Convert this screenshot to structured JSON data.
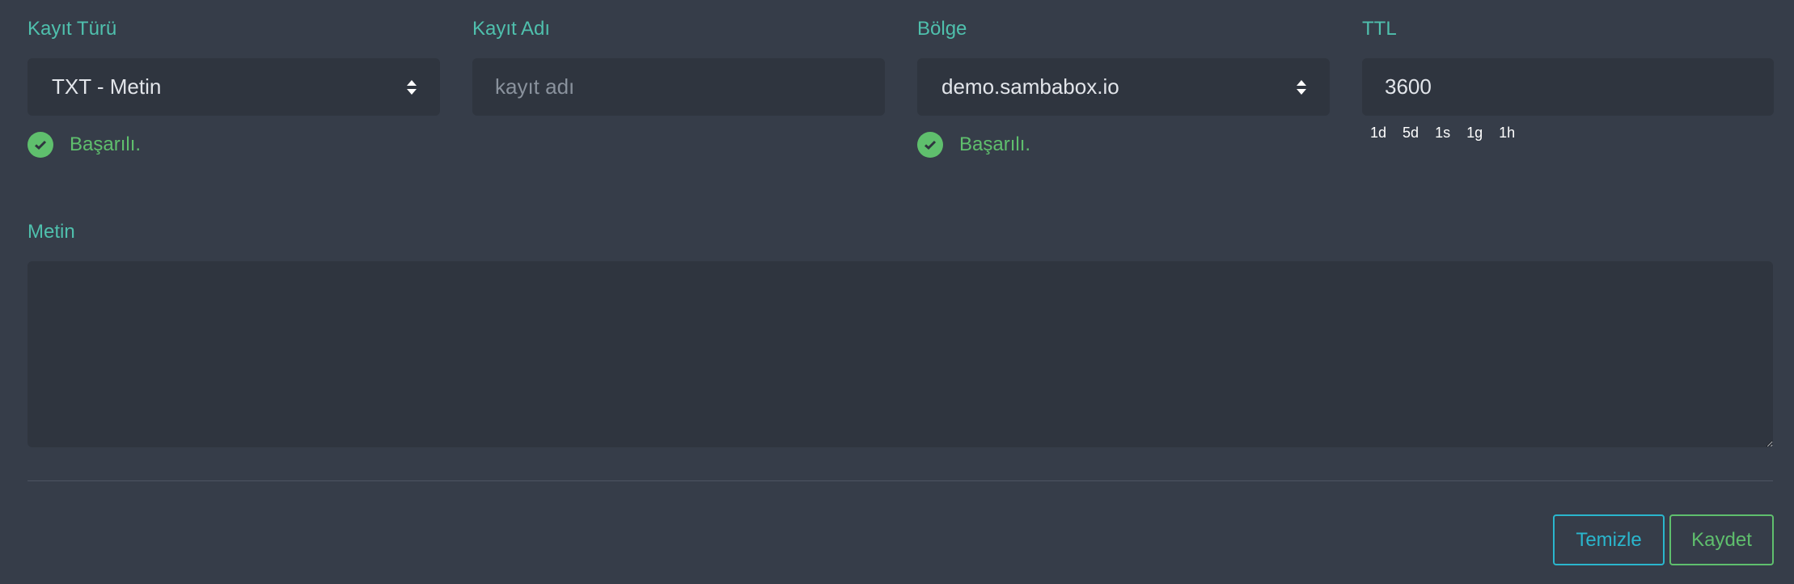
{
  "form": {
    "record_type": {
      "label": "Kayıt Türü",
      "value": "TXT - Metin",
      "status": "Başarılı."
    },
    "record_name": {
      "label": "Kayıt Adı",
      "placeholder": "kayıt adı",
      "value": ""
    },
    "zone": {
      "label": "Bölge",
      "value": "demo.sambabox.io",
      "status": "Başarılı."
    },
    "ttl": {
      "label": "TTL",
      "value": "3600",
      "presets": [
        "1d",
        "5d",
        "1s",
        "1g",
        "1h"
      ]
    },
    "text": {
      "label": "Metin",
      "value": ""
    }
  },
  "actions": {
    "clear_label": "Temizle",
    "save_label": "Kaydet"
  },
  "colors": {
    "background": "#363d49",
    "field_bg": "#2f353f",
    "label": "#4fc0ad",
    "success": "#5fbf6d",
    "clear_button": "#2ab6cd"
  },
  "icons": {
    "select": "sort-icon",
    "status": "check-circle-icon"
  }
}
